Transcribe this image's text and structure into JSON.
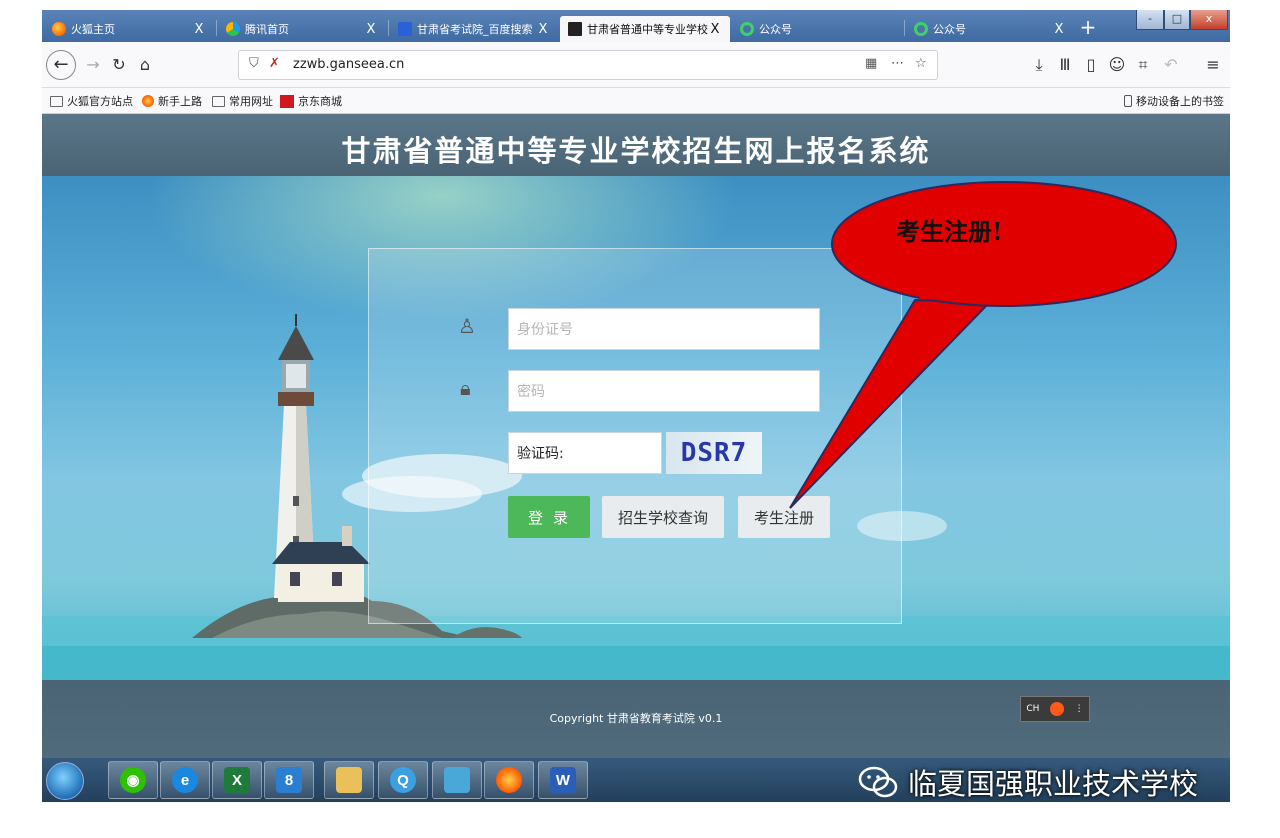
{
  "browser": {
    "tabs": [
      {
        "label": "火狐主页",
        "icon": "firefox-icon",
        "active": false
      },
      {
        "label": "腾讯首页",
        "icon": "tencent-icon",
        "active": false
      },
      {
        "label": "甘肃省考试院_百度搜索",
        "icon": "baidu-icon",
        "active": false
      },
      {
        "label": "甘肃省普通中等专业学校",
        "icon": "site-favicon-icon",
        "active": true
      },
      {
        "label": "公众号",
        "icon": "wechat-public-icon",
        "active": false
      },
      {
        "label": "公众号",
        "icon": "wechat-public-icon",
        "active": false
      }
    ],
    "tab_close_glyph": "X",
    "new_tab_glyph": "+",
    "window_buttons": {
      "minimize": "-",
      "maximize": "□",
      "close": "x"
    },
    "url": "zzwb.ganseea.cn",
    "bookmarks": [
      {
        "label": "火狐官方站点",
        "icon": "folder-icon"
      },
      {
        "label": "新手上路",
        "icon": "firefox-icon"
      },
      {
        "label": "常用网址",
        "icon": "folder-icon"
      },
      {
        "label": "京东商城",
        "icon": "jd-icon"
      }
    ],
    "mobile_bookmarks": "移动设备上的书签"
  },
  "site": {
    "title": "甘肃省普通中等专业学校招生网上报名系统",
    "id_placeholder": "身份证号",
    "password_placeholder": "密码",
    "captcha_label": "验证码:",
    "captcha_text": "DSR7",
    "login_label": "登录",
    "school_query_label": "招生学校查询",
    "register_label": "考生注册",
    "copyright": "Copyright 甘肃省教育考试院 v0.1",
    "ime_label": "CH"
  },
  "annotation": {
    "callout_text": "考生注册!",
    "callout_color": "#e00000"
  },
  "watermark": {
    "text": "临夏国强职业技术学校"
  },
  "colors": {
    "login_green": "#4cb85a",
    "header_slate": "#4f6a7b"
  }
}
